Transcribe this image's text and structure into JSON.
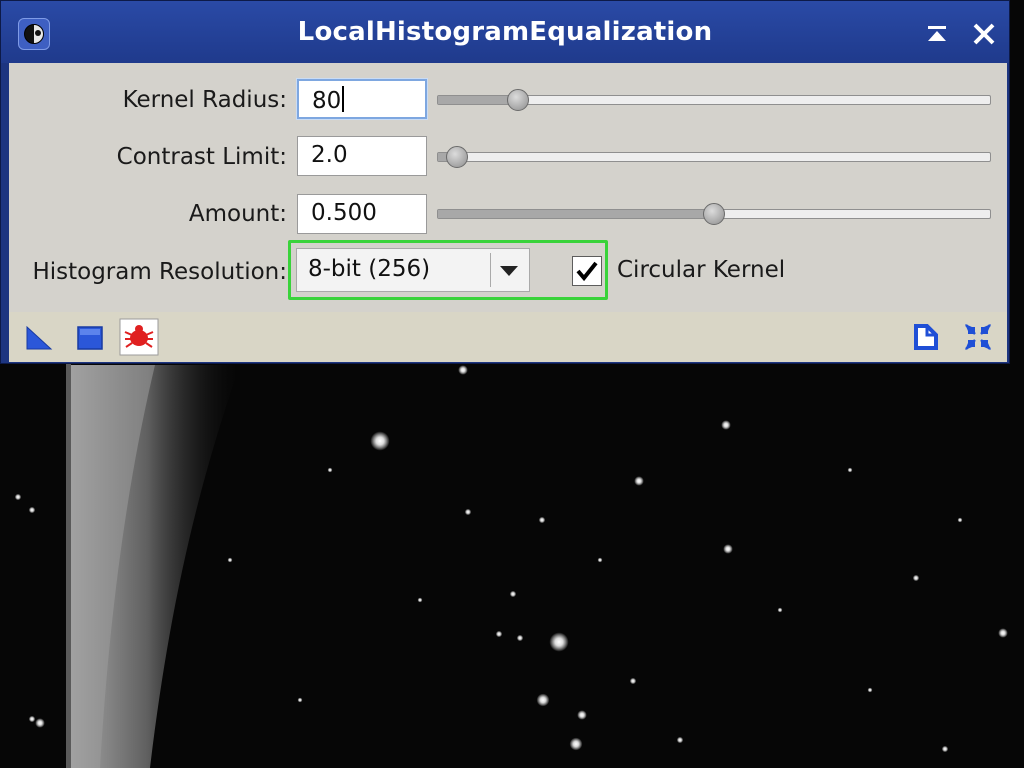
{
  "window": {
    "title": "LocalHistogramEqualization",
    "icons": {
      "app": "process-icon",
      "shade": "shade-icon",
      "close": "close-icon"
    }
  },
  "params": {
    "kernel_radius": {
      "label": "Kernel Radius:",
      "value": "80",
      "slider_fraction": 0.145
    },
    "contrast_limit": {
      "label": "Contrast Limit:",
      "value": "2.0",
      "slider_fraction": 0.035
    },
    "amount": {
      "label": "Amount:",
      "value": "0.500",
      "slider_fraction": 0.5
    }
  },
  "histogram_resolution": {
    "label": "Histogram Resolution:",
    "selected": "8-bit (256)"
  },
  "circular_kernel": {
    "label": "Circular Kernel",
    "checked": true
  },
  "toolbar": {
    "left_icons": [
      "new-instance-icon",
      "apply-global-icon",
      "preview-bug-icon"
    ],
    "right_icons": [
      "description-icon",
      "reset-icon"
    ]
  },
  "colors": {
    "title_bar": "#1f3a8c",
    "highlight": "#39d33a",
    "panel": "#d4d2cc"
  }
}
